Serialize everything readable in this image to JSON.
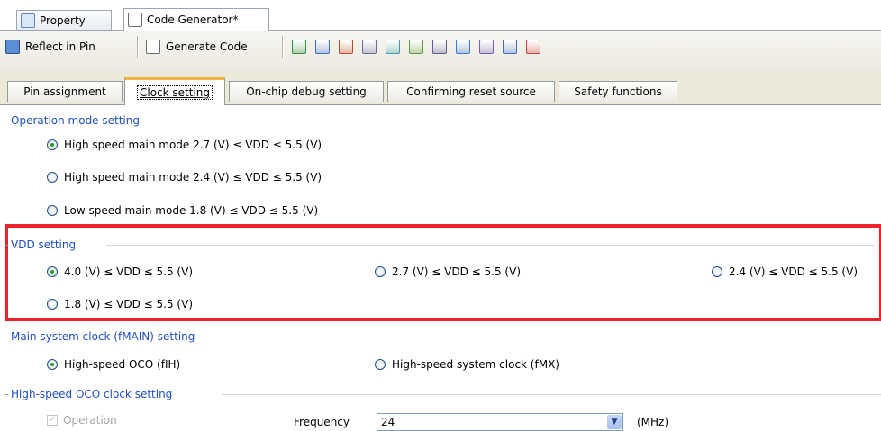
{
  "doc_tabs": {
    "property": "Property",
    "code_generator": "Code Generator*"
  },
  "toolbar": {
    "reflect_in_pin": "Reflect in Pin",
    "generate_code": "Generate Code",
    "icon_names": [
      "pin-icon",
      "port-icon",
      "interrupt-icon",
      "serial-icon",
      "adc-icon",
      "timer-icon",
      "watchdog-icon",
      "rtc-icon",
      "sound-icon",
      "dma-icon",
      "battery-icon"
    ]
  },
  "sub_tabs": [
    "Pin assignment",
    "Clock setting",
    "On-chip debug setting",
    "Confirming reset source",
    "Safety functions"
  ],
  "operation_mode": {
    "title": "Operation mode setting",
    "options": [
      {
        "label": "High speed main mode 2.7 (V) ≤ VDD ≤ 5.5 (V)",
        "selected": true
      },
      {
        "label": "High speed main mode 2.4 (V) ≤ VDD ≤ 5.5 (V)",
        "selected": false
      },
      {
        "label": "Low speed main mode 1.8 (V) ≤ VDD ≤ 5.5 (V)",
        "selected": false
      }
    ]
  },
  "vdd_setting": {
    "title": "VDD setting",
    "options": [
      {
        "label": "4.0 (V) ≤ VDD ≤ 5.5 (V)",
        "selected": true
      },
      {
        "label": "2.7 (V) ≤ VDD ≤ 5.5 (V)",
        "selected": false
      },
      {
        "label": "2.4 (V) ≤ VDD ≤ 5.5 (V)",
        "selected": false
      },
      {
        "label": "1.8 (V) ≤ VDD ≤ 5.5 (V)",
        "selected": false
      }
    ]
  },
  "main_clock": {
    "title": "Main system clock (fMAIN) setting",
    "options": [
      {
        "label": "High-speed OCO (fIH)",
        "selected": true
      },
      {
        "label": "High-speed system clock (fMX)",
        "selected": false
      }
    ]
  },
  "oco_clock": {
    "title": "High-speed OCO clock setting",
    "operation_label": "Operation",
    "frequency_label": "Frequency",
    "frequency_value": "24",
    "unit": "(MHz)"
  },
  "colors": {
    "highlight": "#e8232a",
    "group_title": "#1f4fc8",
    "tab_active_accent": "#f3b444"
  }
}
